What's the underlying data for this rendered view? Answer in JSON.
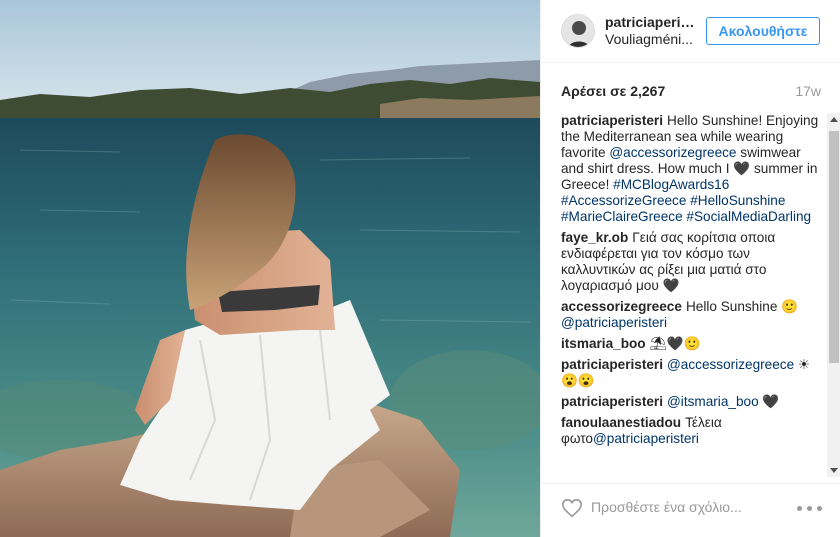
{
  "post": {
    "image": {
      "icon": "beach-photo",
      "alt": ""
    },
    "header": {
      "username": "patriciaperis...",
      "location": "Vouliagméni...",
      "follow_label": "Ακολουθήστε"
    },
    "likes_label": "Αρέσει σε 2,267",
    "timestamp": "17w",
    "caption": {
      "author": "patriciaperisteri",
      "text_1": "Hello Sunshine! Enjoying the Mediterranean sea while wearing favorite ",
      "mention": "@accessorizegreece",
      "text_2": " swimwear and shirt dress. How much I ",
      "heart": "🖤",
      "text_3": " summer in Greece! ",
      "hashtags": "#MCBlogAwards16 #AccessorizeGreece #HelloSunshine #MarieClaireGreece #SocialMediaDarling"
    },
    "comments": [
      {
        "author": "faye_kr.ob",
        "text": "Γειά σας κορίτσια οποια ενδιαφέρεται για τον κόσμο των καλλυντικών ας ρίξει μια ματιά στο λογαριασμό μου 🖤",
        "mention": "",
        "after": ""
      },
      {
        "author": "accessorizegreece",
        "text": "Hello Sunshine 🙂 ",
        "mention": "@patriciaperisteri",
        "after": ""
      },
      {
        "author": "itsmaria_boo",
        "text": "⛱🖤🙂",
        "mention": "",
        "after": ""
      },
      {
        "author": "patriciaperisteri",
        "text": "",
        "mention": "@accessorizegreece",
        "after": " ☀ 😮😮"
      },
      {
        "author": "patriciaperisteri",
        "text": "",
        "mention": "@itsmaria_boo",
        "after": " 🖤"
      },
      {
        "author": "fanoulaanestiadou",
        "text": "Τέλεια φωτο",
        "mention": "@patriciaperisteri",
        "after": ""
      }
    ],
    "footer": {
      "comment_placeholder": "Προσθέστε ένα σχόλιο...",
      "like_icon": "heart-outline-icon",
      "more_icon": "more-options-icon"
    }
  },
  "colors": {
    "link": "#003569",
    "follow_blue": "#3897f0",
    "muted": "#999999",
    "text": "#262626"
  }
}
